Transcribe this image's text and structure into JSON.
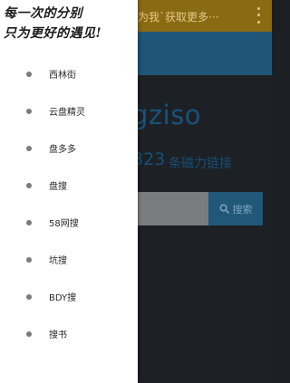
{
  "main": {
    "app_bar_text": "为我`获取更多···",
    "site_title": "gziso",
    "magnet_count": "323",
    "magnet_label": "条磁力链接",
    "search": {
      "value": "",
      "button_label": "搜索"
    }
  },
  "drawer": {
    "header_lines": [
      "每一次的分别",
      "只为更好的遇见!"
    ],
    "items": [
      {
        "label": "西林街"
      },
      {
        "label": "云盘精灵"
      },
      {
        "label": "盘多多"
      },
      {
        "label": "盘搜"
      },
      {
        "label": "58网搜"
      },
      {
        "label": "坑搜"
      },
      {
        "label": "BDY搜"
      },
      {
        "label": "搜书"
      }
    ]
  },
  "colors": {
    "app_bar": "#8a6a12",
    "accent_blue": "#1f5576",
    "scrim_background": "#1d2126",
    "drawer_background": "#ffffff"
  },
  "icons": {
    "overflow_menu": "more-vertical-icon",
    "search_button": "search-icon",
    "drawer_bullet": "bullet-icon"
  }
}
